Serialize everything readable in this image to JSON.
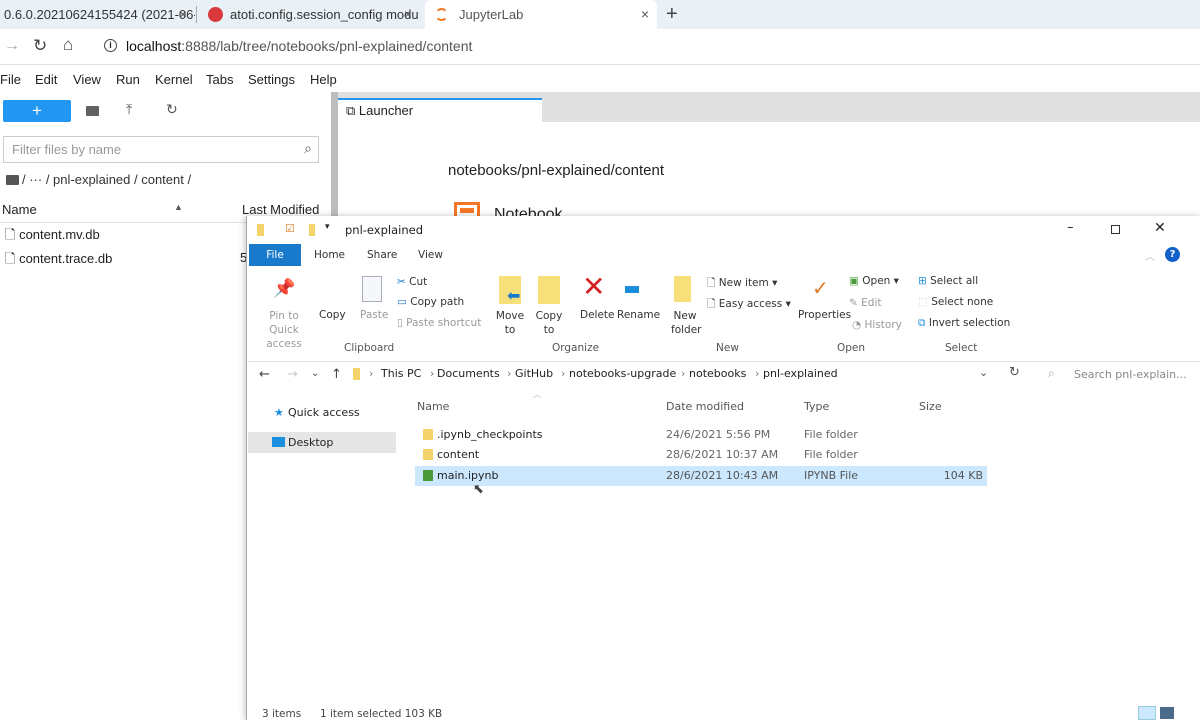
{
  "browser": {
    "tabs": [
      {
        "title": "0.6.0.20210624155424 (2021-06-..."
      },
      {
        "title": "atoti.config.session_config modu"
      },
      {
        "title": "JupyterLab"
      }
    ],
    "close": "×",
    "new_tab": "+",
    "url_host": "localhost",
    "url_rest": ":8888/lab/tree/notebooks/pnl-explained/content"
  },
  "jupyter": {
    "menu": [
      "File",
      "Edit",
      "View",
      "Run",
      "Kernel",
      "Tabs",
      "Settings",
      "Help"
    ],
    "new_label": "+",
    "filter_placeholder": "Filter files by name",
    "breadcrumb": "/  ···  / pnl-explained / content /",
    "col_name": "Name",
    "col_modified": "Last Modified",
    "files": [
      {
        "name": "content.mv.db"
      },
      {
        "name": "content.trace.db",
        "modified": "5"
      }
    ],
    "launcher_tab": "Launcher",
    "launcher_path": "notebooks/pnl-explained/content",
    "launcher_notebook": "Notebook",
    "accent": "#2196f3"
  },
  "explorer": {
    "title": "pnl-explained",
    "ribbon_tabs": [
      "File",
      "Home",
      "Share",
      "View"
    ],
    "clipboard": {
      "pin": "Pin to Quick access",
      "copy": "Copy",
      "paste": "Paste",
      "cut": "Cut",
      "copy_path": "Copy path",
      "paste_shortcut": "Paste shortcut",
      "group": "Clipboard"
    },
    "organize": {
      "move": "Move to",
      "copy": "Copy to",
      "delete": "Delete",
      "rename": "Rename",
      "group": "Organize"
    },
    "new": {
      "folder": "New folder",
      "item": "New item",
      "easy": "Easy access",
      "group": "New"
    },
    "open": {
      "properties": "Properties",
      "open": "Open",
      "edit": "Edit",
      "history": "History",
      "group": "Open"
    },
    "select": {
      "all": "Select all",
      "none": "Select none",
      "invert": "Invert selection",
      "group": "Select"
    },
    "path": [
      "This PC",
      "Documents",
      "GitHub",
      "notebooks-upgrade",
      "notebooks",
      "pnl-explained"
    ],
    "search_placeholder": "Search pnl-explain...",
    "nav": [
      "Quick access",
      "Desktop"
    ],
    "columns": [
      "Name",
      "Date modified",
      "Type",
      "Size"
    ],
    "rows": [
      {
        "name": ".ipynb_checkpoints",
        "date": "24/6/2021 5:56 PM",
        "type": "File folder",
        "size": ""
      },
      {
        "name": "content",
        "date": "28/6/2021 10:37 AM",
        "type": "File folder",
        "size": ""
      },
      {
        "name": "main.ipynb",
        "date": "28/6/2021 10:43 AM",
        "type": "IPYNB File",
        "size": "104 KB"
      }
    ],
    "status_items": "3 items",
    "status_selected": "1 item selected  103 KB",
    "accent": "#1979ca"
  }
}
